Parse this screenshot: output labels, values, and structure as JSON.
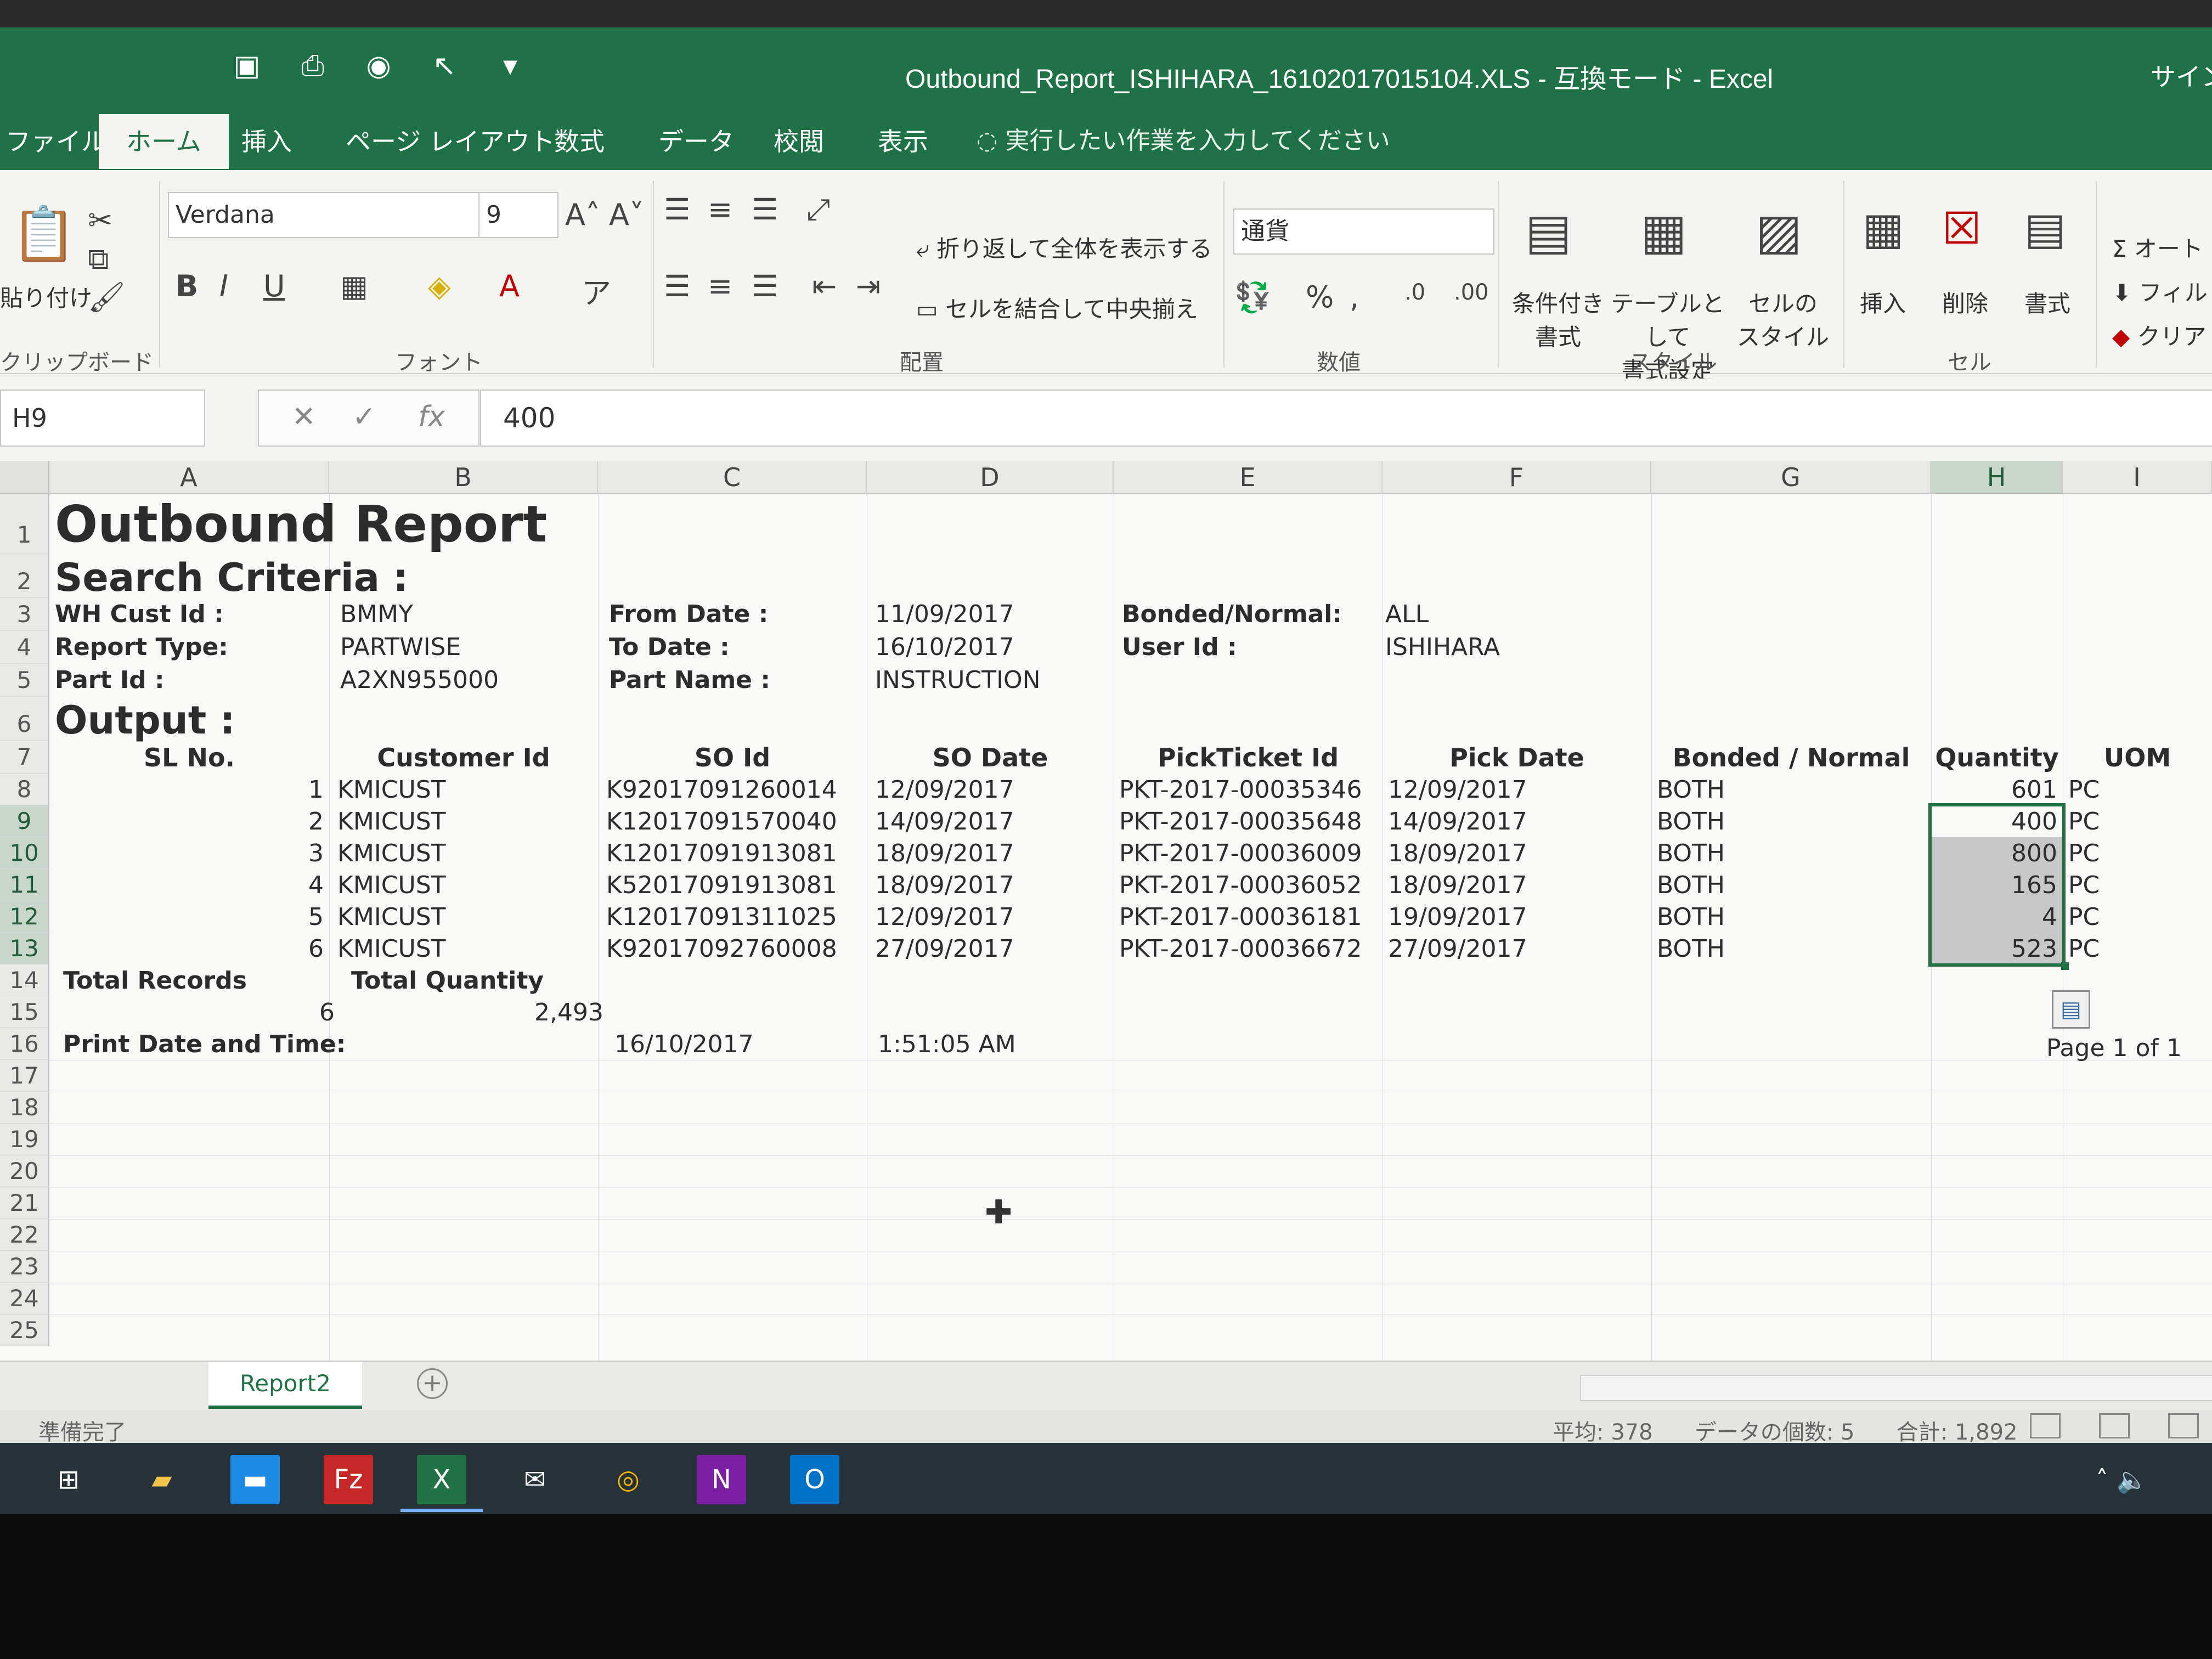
{
  "window": {
    "title": "Outbound_Report_ISHIHARA_16102017015104.XLS  -  互換モード  -  Excel",
    "signin": "サイン"
  },
  "tabs": [
    {
      "label": "ファイル"
    },
    {
      "label": "ホーム"
    },
    {
      "label": "挿入"
    },
    {
      "label": "ページ レイアウト"
    },
    {
      "label": "数式"
    },
    {
      "label": "データ"
    },
    {
      "label": "校閲"
    },
    {
      "label": "表示"
    }
  ],
  "tellme": "実行したい作業を入力してください",
  "ribbon": {
    "clipboard": {
      "paste": "貼り付け",
      "label": "クリップボード"
    },
    "font": {
      "name": "Verdana",
      "size": "9",
      "label": "フォント"
    },
    "alignment": {
      "wrap": "折り返して全体を表示する",
      "merge": "セルを結合して中央揃え",
      "label": "配置"
    },
    "number": {
      "format": "通貨",
      "label": "数値"
    },
    "styles": {
      "conditional": "条件付き\n書式",
      "table": "テーブルとして\n書式設定",
      "cellstyle": "セルの\nスタイル",
      "label": "スタイル"
    },
    "cells": {
      "insert": "挿入",
      "delete": "削除",
      "format": "書式",
      "label": "セル"
    },
    "editing": {
      "autosum": "オート",
      "fill": "フィル",
      "clear": "クリア"
    }
  },
  "formula_bar": {
    "name_box": "H9",
    "value": "400"
  },
  "columns": [
    "A",
    "B",
    "C",
    "D",
    "E",
    "F",
    "G",
    "H",
    "I"
  ],
  "rows": [
    "1",
    "2",
    "3",
    "4",
    "5",
    "6",
    "7",
    "8",
    "9",
    "10",
    "11",
    "12",
    "13",
    "14",
    "15",
    "16",
    "17",
    "18",
    "19",
    "20",
    "21",
    "22",
    "23",
    "24",
    "25"
  ],
  "report": {
    "title": "Outbound Report",
    "search_criteria": "Search Criteria :",
    "wh_cust_id_label": "WH Cust Id :",
    "wh_cust_id": "BMMY",
    "report_type_label": "Report Type:",
    "report_type": "PARTWISE",
    "part_id_label": "Part Id :",
    "part_id": "A2XN955000",
    "from_date_label": "From Date :",
    "from_date": "11/09/2017",
    "to_date_label": "To Date :",
    "to_date": "16/10/2017",
    "part_name_label": "Part Name :",
    "part_name": "INSTRUCTION",
    "bonded_label": "Bonded/Normal:",
    "bonded": "ALL",
    "user_id_label": "User Id :",
    "user_id": "ISHIHARA",
    "output": "Output :",
    "headers": [
      "SL No.",
      "Customer Id",
      "SO Id",
      "SO Date",
      "PickTicket Id",
      "Pick Date",
      "Bonded / Normal",
      "Quantity",
      "UOM"
    ],
    "rows": [
      {
        "sl": "1",
        "customer": "KMICUST",
        "so_id": "K92017091260014",
        "so_date": "12/09/2017",
        "pick_id": "PKT-2017-00035346",
        "pick_date": "12/09/2017",
        "bonded": "BOTH",
        "qty": "601",
        "uom": "PC"
      },
      {
        "sl": "2",
        "customer": "KMICUST",
        "so_id": "K12017091570040",
        "so_date": "14/09/2017",
        "pick_id": "PKT-2017-00035648",
        "pick_date": "14/09/2017",
        "bonded": "BOTH",
        "qty": "400",
        "uom": "PC"
      },
      {
        "sl": "3",
        "customer": "KMICUST",
        "so_id": "K12017091913081",
        "so_date": "18/09/2017",
        "pick_id": "PKT-2017-00036009",
        "pick_date": "18/09/2017",
        "bonded": "BOTH",
        "qty": "800",
        "uom": "PC"
      },
      {
        "sl": "4",
        "customer": "KMICUST",
        "so_id": "K52017091913081",
        "so_date": "18/09/2017",
        "pick_id": "PKT-2017-00036052",
        "pick_date": "18/09/2017",
        "bonded": "BOTH",
        "qty": "165",
        "uom": "PC"
      },
      {
        "sl": "5",
        "customer": "KMICUST",
        "so_id": "K12017091311025",
        "so_date": "12/09/2017",
        "pick_id": "PKT-2017-00036181",
        "pick_date": "19/09/2017",
        "bonded": "BOTH",
        "qty": "4",
        "uom": "PC"
      },
      {
        "sl": "6",
        "customer": "KMICUST",
        "so_id": "K92017092760008",
        "so_date": "27/09/2017",
        "pick_id": "PKT-2017-00036672",
        "pick_date": "27/09/2017",
        "bonded": "BOTH",
        "qty": "523",
        "uom": "PC"
      }
    ],
    "total_records_label": "Total Records",
    "total_quantity_label": "Total Quantity",
    "total_records": "6",
    "total_quantity": "2,493",
    "print_label": "Print Date and Time:",
    "print_date": "16/10/2017",
    "print_time": "1:51:05 AM",
    "page": "Page 1 of 1"
  },
  "sheet": {
    "tab": "Report2"
  },
  "status": {
    "ready": "準備完了",
    "average": "平均: 378",
    "count": "データの個数: 5",
    "sum": "合計: 1,892"
  },
  "colors": {
    "excel_green": "#1f7246",
    "selection": "#217346",
    "taskbar": "#263238"
  }
}
